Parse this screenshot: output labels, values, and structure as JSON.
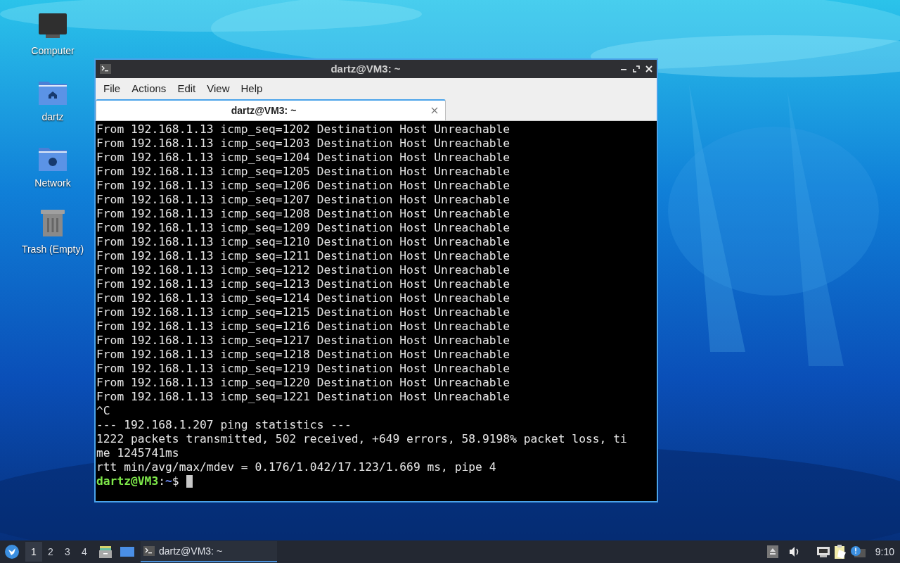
{
  "desktop_icons": [
    {
      "kind": "computer",
      "label": "Computer"
    },
    {
      "kind": "home",
      "label": "dartz"
    },
    {
      "kind": "network",
      "label": "Network"
    },
    {
      "kind": "trash",
      "label": "Trash (Empty)"
    }
  ],
  "window": {
    "title": "dartz@VM3: ~",
    "menu": [
      "File",
      "Actions",
      "Edit",
      "View",
      "Help"
    ],
    "tabs": [
      {
        "label": "dartz@VM3: ~",
        "selected": true
      }
    ],
    "terminal": {
      "lines": [
        "From 192.168.1.13 icmp_seq=1202 Destination Host Unreachable",
        "From 192.168.1.13 icmp_seq=1203 Destination Host Unreachable",
        "From 192.168.1.13 icmp_seq=1204 Destination Host Unreachable",
        "From 192.168.1.13 icmp_seq=1205 Destination Host Unreachable",
        "From 192.168.1.13 icmp_seq=1206 Destination Host Unreachable",
        "From 192.168.1.13 icmp_seq=1207 Destination Host Unreachable",
        "From 192.168.1.13 icmp_seq=1208 Destination Host Unreachable",
        "From 192.168.1.13 icmp_seq=1209 Destination Host Unreachable",
        "From 192.168.1.13 icmp_seq=1210 Destination Host Unreachable",
        "From 192.168.1.13 icmp_seq=1211 Destination Host Unreachable",
        "From 192.168.1.13 icmp_seq=1212 Destination Host Unreachable",
        "From 192.168.1.13 icmp_seq=1213 Destination Host Unreachable",
        "From 192.168.1.13 icmp_seq=1214 Destination Host Unreachable",
        "From 192.168.1.13 icmp_seq=1215 Destination Host Unreachable",
        "From 192.168.1.13 icmp_seq=1216 Destination Host Unreachable",
        "From 192.168.1.13 icmp_seq=1217 Destination Host Unreachable",
        "From 192.168.1.13 icmp_seq=1218 Destination Host Unreachable",
        "From 192.168.1.13 icmp_seq=1219 Destination Host Unreachable",
        "From 192.168.1.13 icmp_seq=1220 Destination Host Unreachable",
        "From 192.168.1.13 icmp_seq=1221 Destination Host Unreachable",
        "^C",
        "--- 192.168.1.207 ping statistics ---",
        "1222 packets transmitted, 502 received, +649 errors, 58.9198% packet loss, ti",
        "me 1245741ms",
        "rtt min/avg/max/mdev = 0.176/1.042/17.123/1.669 ms, pipe 4"
      ],
      "prompt": {
        "user_host": "dartz@VM3",
        "colon": ":",
        "path": "~",
        "symbol": "$",
        "cursor": true
      }
    }
  },
  "taskbar": {
    "workspaces": [
      {
        "label": "1",
        "selected": true
      },
      {
        "label": "2",
        "selected": false
      },
      {
        "label": "3",
        "selected": false
      },
      {
        "label": "4",
        "selected": false
      }
    ],
    "tasks": [
      {
        "label": "dartz@VM3: ~",
        "selected": true
      }
    ],
    "clock": "9:10"
  }
}
